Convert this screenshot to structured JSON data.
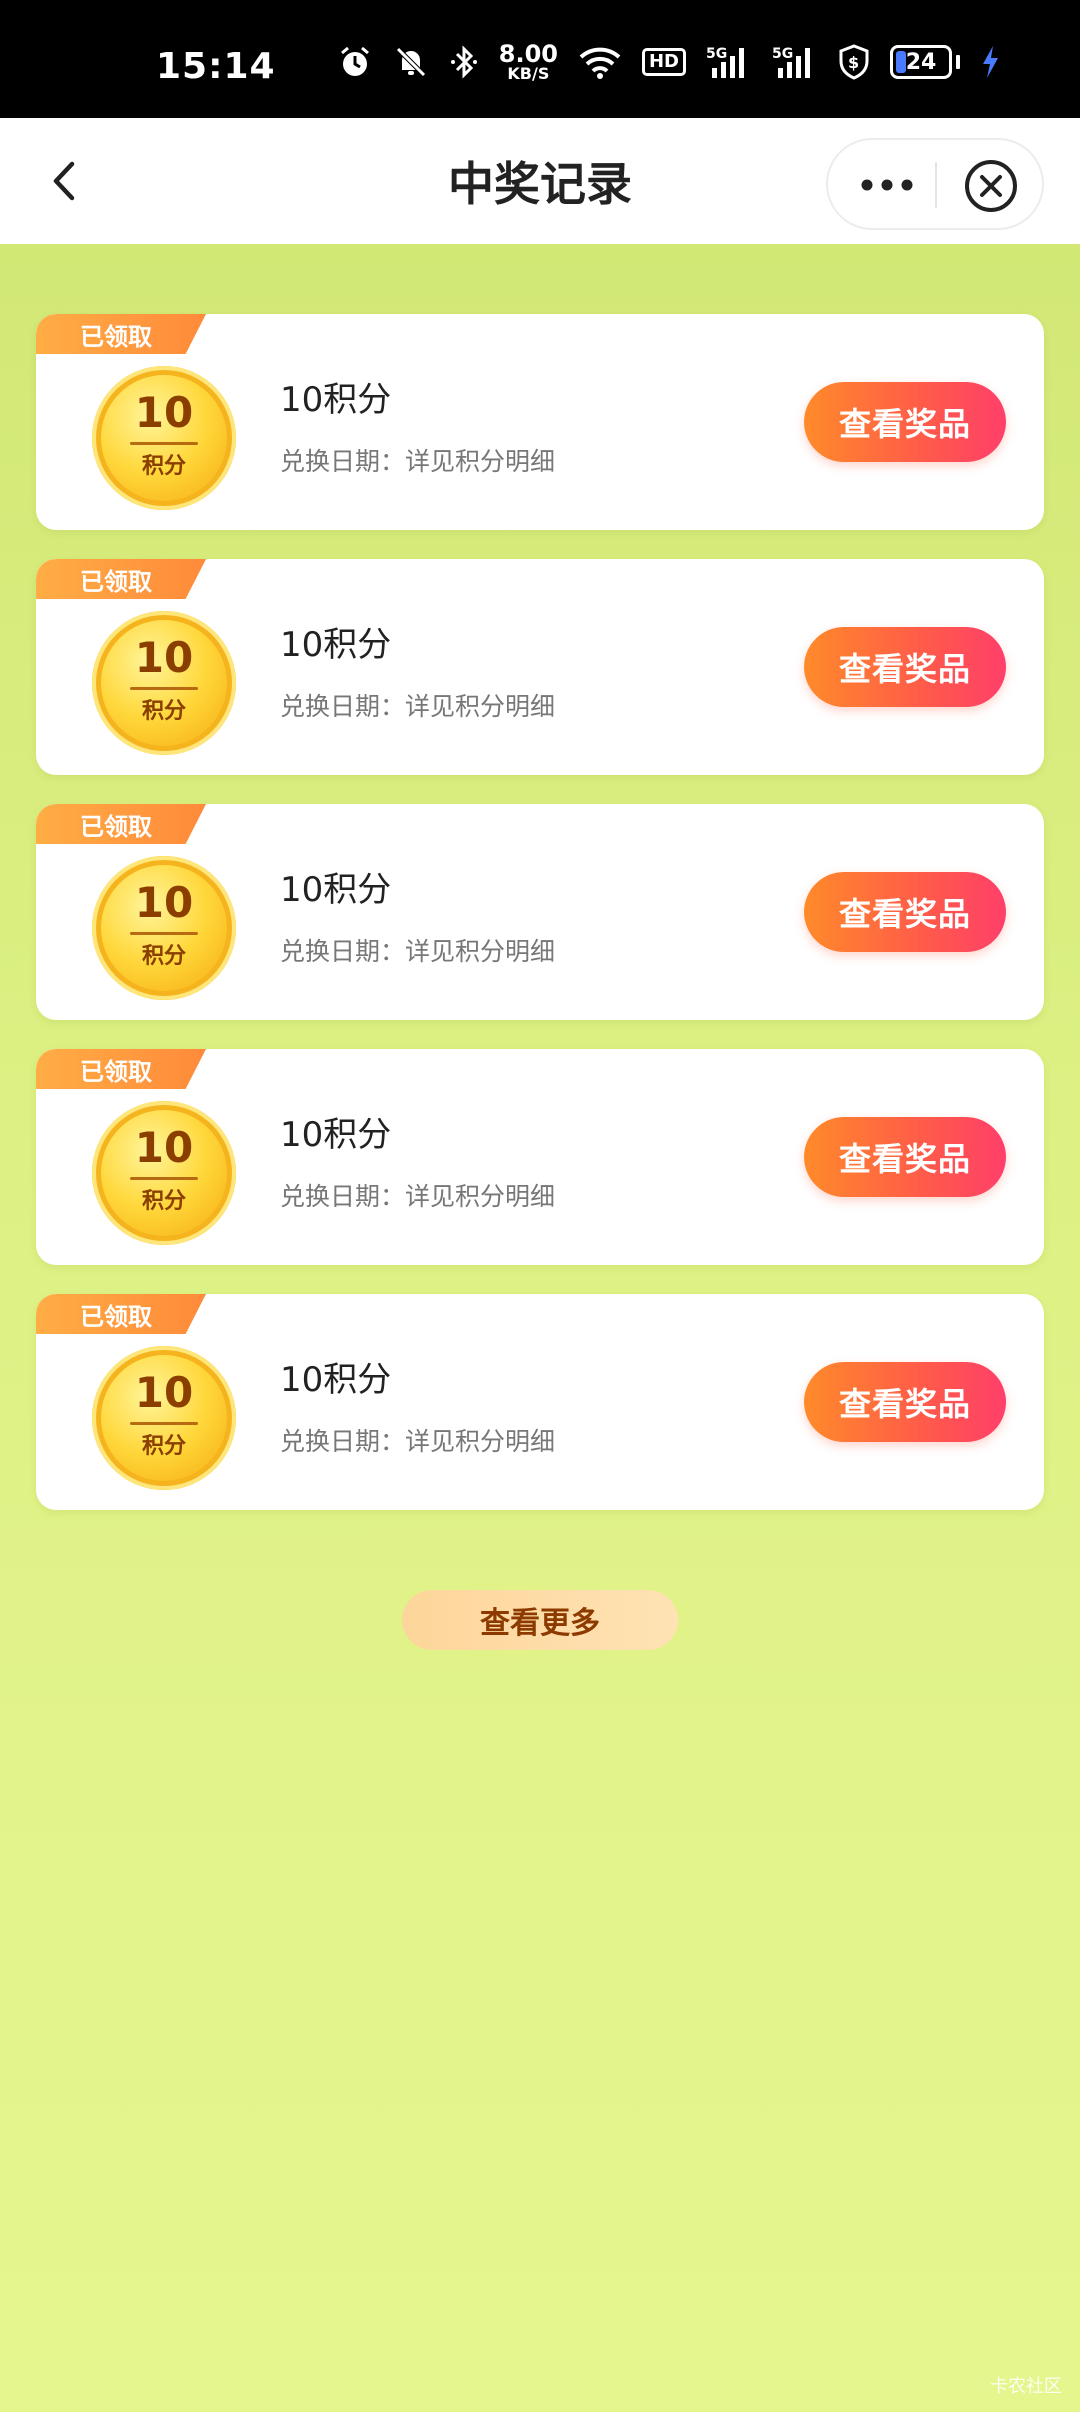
{
  "status_bar": {
    "time": "15:14",
    "net_speed": "8.00",
    "net_unit": "KB/S",
    "hd_label": "HD",
    "signal_label": "5G",
    "battery_level": "24",
    "icons": [
      "alarm-icon",
      "mute-icon",
      "bluetooth-icon",
      "wifi-icon",
      "signal-icon",
      "shield-icon",
      "battery-icon",
      "charging-icon"
    ]
  },
  "nav": {
    "title": "中奖记录",
    "back_icon": "chevron-left-icon",
    "more_icon": "more-dots-icon",
    "close_icon": "close-circle-icon"
  },
  "records": [
    {
      "badge": "已领取",
      "coin_value": "10",
      "coin_unit": "积分",
      "name": "10积分",
      "date": "兑换日期：详见积分明细",
      "button": "查看奖品"
    },
    {
      "badge": "已领取",
      "coin_value": "10",
      "coin_unit": "积分",
      "name": "10积分",
      "date": "兑换日期：详见积分明细",
      "button": "查看奖品"
    },
    {
      "badge": "已领取",
      "coin_value": "10",
      "coin_unit": "积分",
      "name": "10积分",
      "date": "兑换日期：详见积分明细",
      "button": "查看奖品"
    },
    {
      "badge": "已领取",
      "coin_value": "10",
      "coin_unit": "积分",
      "name": "10积分",
      "date": "兑换日期：详见积分明细",
      "button": "查看奖品"
    },
    {
      "badge": "已领取",
      "coin_value": "10",
      "coin_unit": "积分",
      "name": "10积分",
      "date": "兑换日期：详见积分明细",
      "button": "查看奖品"
    }
  ],
  "more_button": "查看更多",
  "watermark": "卡农社区",
  "colors": {
    "background": "#d8ec7d",
    "badge": "#ff9a3e",
    "button_start": "#ff8a2a",
    "button_end": "#ff3f6a",
    "more_button": "#fdd59a"
  }
}
